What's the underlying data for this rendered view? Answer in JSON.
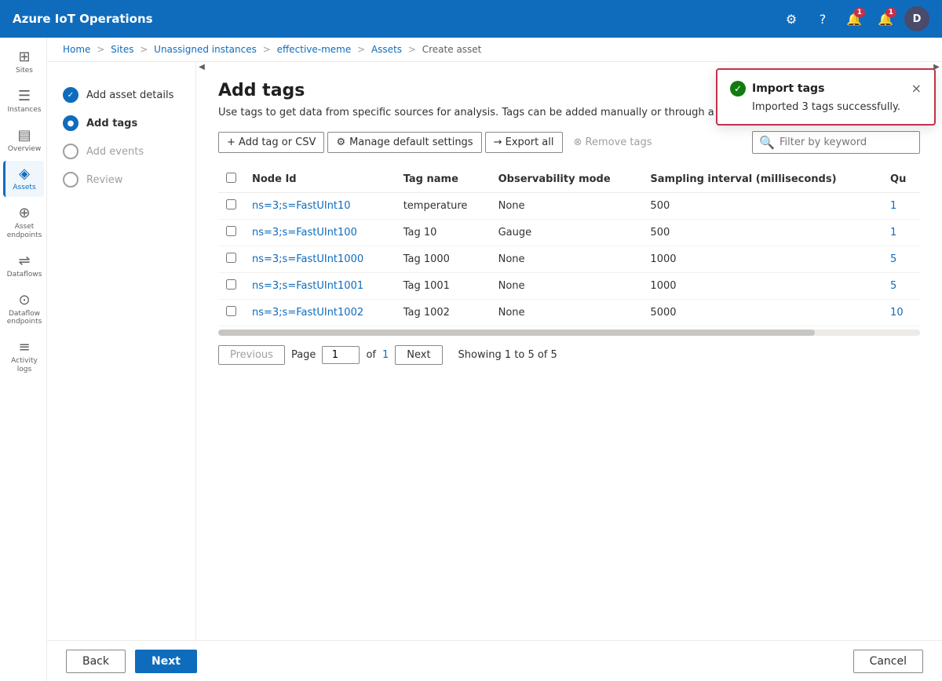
{
  "app": {
    "title": "Azure IoT Operations"
  },
  "navbar": {
    "icons": {
      "settings": "⚙",
      "help": "?",
      "notifications_1": "🔔",
      "notifications_2": "🔔",
      "avatar": "D"
    },
    "badge1": "1",
    "badge2": "1"
  },
  "breadcrumb": {
    "items": [
      "Home",
      "Sites",
      "Unassigned instances",
      "effective-meme",
      "Assets",
      "Create asset"
    ],
    "separators": [
      ">",
      ">",
      ">",
      ">",
      ">"
    ]
  },
  "steps": [
    {
      "id": "add-asset-details",
      "label": "Add asset details",
      "state": "completed"
    },
    {
      "id": "add-tags",
      "label": "Add tags",
      "state": "active"
    },
    {
      "id": "add-events",
      "label": "Add events",
      "state": "inactive"
    },
    {
      "id": "review",
      "label": "Review",
      "state": "inactive"
    }
  ],
  "page": {
    "title": "Add tags",
    "description": "Use tags to get data from specific sources for analysis. Tags can be added manually or through a CSV file."
  },
  "toolbar": {
    "add_label": "+ Add tag or CSV",
    "manage_label": "Manage default settings",
    "export_label": "→ Export all",
    "remove_label": "⊗ Remove tags",
    "filter_placeholder": "Filter by keyword"
  },
  "table": {
    "columns": [
      "Node Id",
      "Tag name",
      "Observability mode",
      "Sampling interval (milliseconds)",
      "Qu"
    ],
    "rows": [
      {
        "node_id": "ns=3;s=FastUInt10",
        "tag_name": "temperature",
        "observability": "None",
        "sampling": "500",
        "qu": "1"
      },
      {
        "node_id": "ns=3;s=FastUInt100",
        "tag_name": "Tag 10",
        "observability": "Gauge",
        "sampling": "500",
        "qu": "1"
      },
      {
        "node_id": "ns=3;s=FastUInt1000",
        "tag_name": "Tag 1000",
        "observability": "None",
        "sampling": "1000",
        "qu": "5"
      },
      {
        "node_id": "ns=3;s=FastUInt1001",
        "tag_name": "Tag 1001",
        "observability": "None",
        "sampling": "1000",
        "qu": "5"
      },
      {
        "node_id": "ns=3;s=FastUInt1002",
        "tag_name": "Tag 1002",
        "observability": "None",
        "sampling": "5000",
        "qu": "10"
      }
    ]
  },
  "pagination": {
    "previous_label": "Previous",
    "next_label": "Next",
    "page_label": "Page",
    "of_label": "of",
    "current_page": "1",
    "total_pages": "1",
    "showing_text": "Showing 1 to 5 of 5"
  },
  "bottom_bar": {
    "back_label": "Back",
    "next_label": "Next",
    "cancel_label": "Cancel"
  },
  "toast": {
    "title": "Import tags",
    "body": "Imported 3 tags successfully.",
    "close_label": "×"
  },
  "sidebar": {
    "items": [
      {
        "id": "sites",
        "label": "Sites",
        "icon": "⊞"
      },
      {
        "id": "instances",
        "label": "Instances",
        "icon": "☰"
      },
      {
        "id": "overview",
        "label": "Overview",
        "icon": "▤"
      },
      {
        "id": "assets",
        "label": "Assets",
        "icon": "◈"
      },
      {
        "id": "asset-endpoints",
        "label": "Asset endpoints",
        "icon": "⊕"
      },
      {
        "id": "dataflows",
        "label": "Dataflows",
        "icon": "⇌"
      },
      {
        "id": "dataflow-endpoints",
        "label": "Dataflow endpoints",
        "icon": "⊙"
      },
      {
        "id": "activity-logs",
        "label": "Activity logs",
        "icon": "≡"
      }
    ]
  }
}
